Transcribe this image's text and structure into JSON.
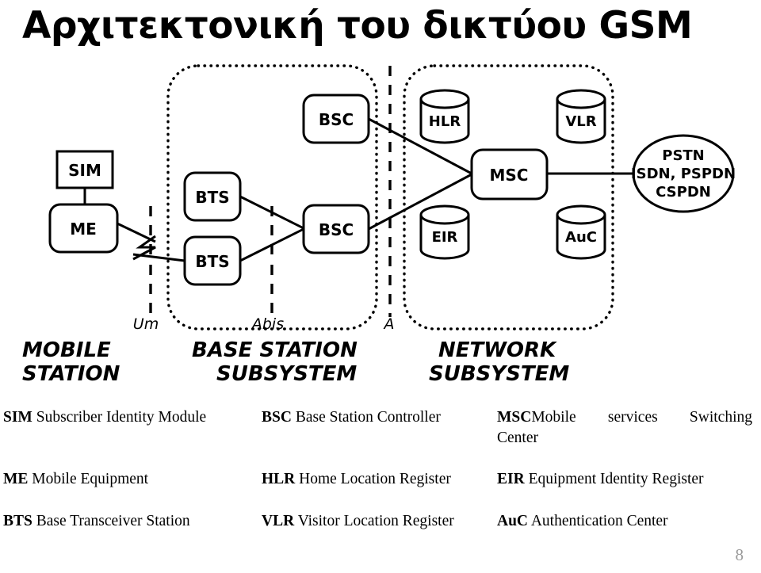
{
  "title": "Αρχιτεκτονική του δικτύου GSM",
  "page_number": "8",
  "diagram": {
    "nodes": {
      "sim": "SIM",
      "me": "ME",
      "bts_upper": "BTS",
      "bts_lower": "BTS",
      "bsc_upper": "BSC",
      "bsc_lower": "BSC",
      "hlr": "HLR",
      "vlr": "VLR",
      "msc": "MSC",
      "eir": "EIR",
      "auc": "AuC",
      "external_line1": "PSTN",
      "external_line2": "ISDN, PSPDN",
      "external_line3": "CSPDN"
    },
    "interfaces": {
      "um": "Um",
      "abis": "Abis",
      "a": "A"
    },
    "zones": {
      "mobile_station_line1": "MOBILE",
      "mobile_station_line2": "STATION",
      "base_station_line1": "BASE STATION",
      "base_station_line2": "SUBSYSTEM",
      "network_line1": "NETWORK",
      "network_line2": "SUBSYSTEM"
    }
  },
  "legend": {
    "rows": [
      {
        "c1_abbr": "SIM",
        "c1_text": " Subscriber Identity Module",
        "c2_abbr": "BSC",
        "c2_text": " Base Station Controller",
        "c3_abbr": "MSC",
        "c3_line1": "Mobile services Switching",
        "c3_line2": "Center"
      },
      {
        "c1_abbr": "ME",
        "c1_text": " Mobile Equipment",
        "c2_abbr": "HLR",
        "c2_text": " Home Location Register",
        "c3_abbr": "EIR",
        "c3_text": " Equipment Identity Register"
      },
      {
        "c1_abbr": "BTS",
        "c1_text": " Base Transceiver Station",
        "c2_abbr": "VLR",
        "c2_text": " Visitor Location Register",
        "c3_abbr": "AuC",
        "c3_text": " Authentication Center"
      }
    ]
  }
}
